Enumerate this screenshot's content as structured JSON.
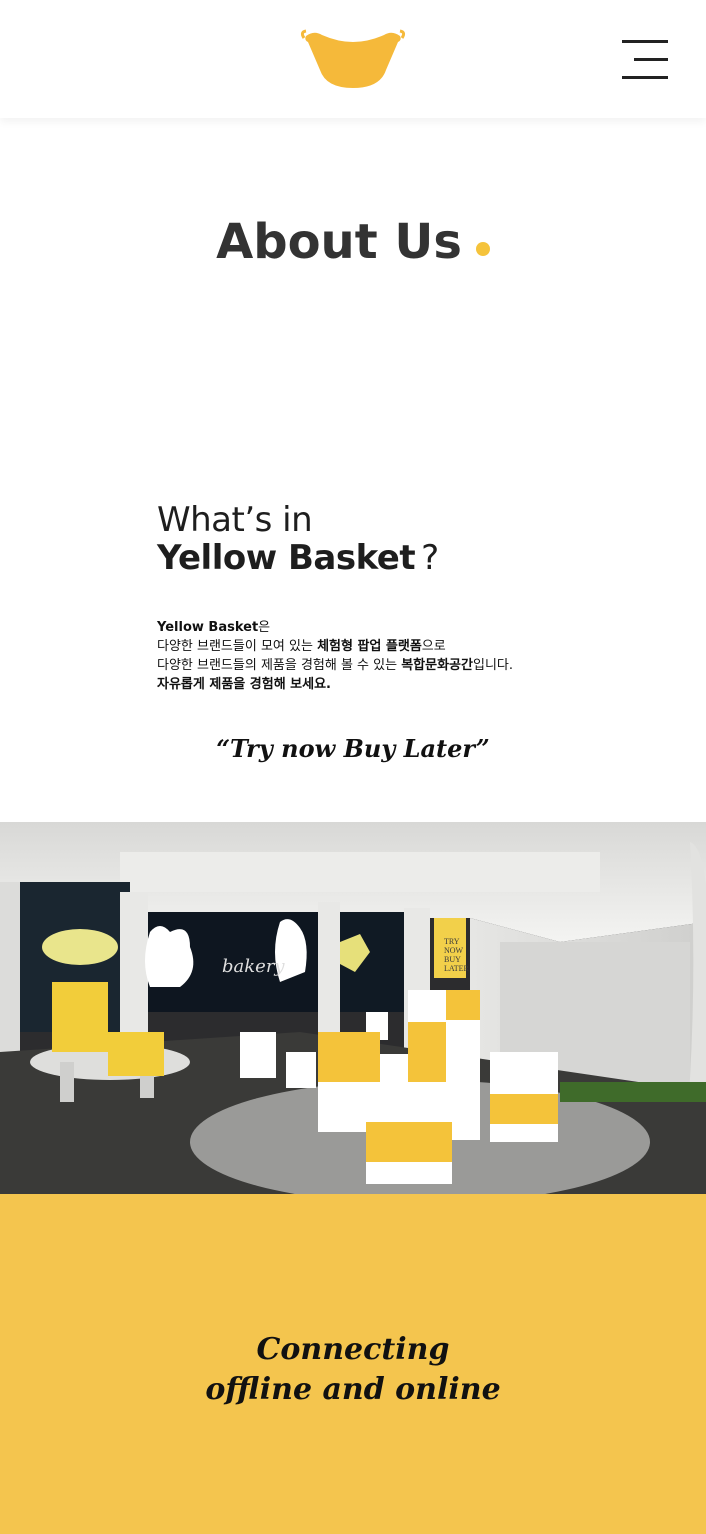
{
  "header": {
    "logo_name": "Yellow Basket logo",
    "menu_icon": "hamburger-menu-icon"
  },
  "about": {
    "title": "About Us"
  },
  "intro": {
    "line1": "What’s in",
    "line2_bold": "Yellow Basket",
    "line2_mark": "?",
    "p1_bold": "Yellow Basket",
    "p1_rest": "은",
    "p2_a": "다양한 브랜드들이 모여 있는 ",
    "p2_bold": "체험형 팝업 플랫폼",
    "p2_b": "으로",
    "p3_a": "다양한 브랜드들의 제품을 경험해 볼 수 있는 ",
    "p3_bold": "복합문화공간",
    "p3_b": "입니다.",
    "p4_bold": "자유롭게 제품을 경험해 보세요.",
    "tagline": "“Try now Buy Later”"
  },
  "photo": {
    "sign": [
      "TRY",
      "NOW",
      "BUY",
      "LATER"
    ],
    "window_text": "bakery"
  },
  "connect": {
    "line1": "Connecting",
    "line2": "offline and online"
  },
  "colors": {
    "brand_yellow": "#f4c54e",
    "text_dark": "#222222"
  }
}
